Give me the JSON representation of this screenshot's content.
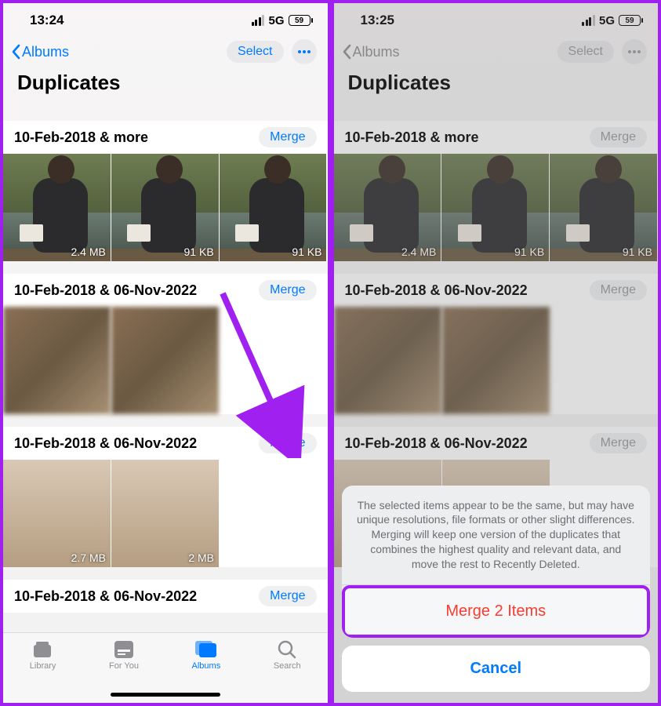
{
  "left": {
    "status": {
      "time": "13:24",
      "network": "5G",
      "battery": "59"
    },
    "nav": {
      "back_label": "Albums",
      "select_label": "Select"
    },
    "page_title": "Duplicates",
    "sections": [
      {
        "title": "10-Feb-2018 & more",
        "merge_label": "Merge",
        "thumbs": [
          {
            "size": "2.4 MB"
          },
          {
            "size": "91 KB"
          },
          {
            "size": "91 KB"
          }
        ]
      },
      {
        "title": "10-Feb-2018 & 06-Nov-2022",
        "merge_label": "Merge",
        "thumbs": [
          {
            "size": ""
          },
          {
            "size": ""
          }
        ],
        "blur": true
      },
      {
        "title": "10-Feb-2018 & 06-Nov-2022",
        "merge_label": "Merge",
        "thumbs": [
          {
            "size": "2.7 MB"
          },
          {
            "size": "2 MB"
          }
        ]
      },
      {
        "title": "10-Feb-2018 & 06-Nov-2022",
        "merge_label": "Merge",
        "thumbs": []
      }
    ],
    "tabs": {
      "library": "Library",
      "foryou": "For You",
      "albums": "Albums",
      "search": "Search"
    }
  },
  "right": {
    "status": {
      "time": "13:25",
      "network": "5G",
      "battery": "59"
    },
    "nav": {
      "back_label": "Albums",
      "select_label": "Select"
    },
    "page_title": "Duplicates",
    "sections": [
      {
        "title": "10-Feb-2018 & more",
        "merge_label": "Merge",
        "thumbs": [
          {
            "size": "2.4 MB"
          },
          {
            "size": "91 KB"
          },
          {
            "size": "91 KB"
          }
        ]
      },
      {
        "title": "10-Feb-2018 & 06-Nov-2022",
        "merge_label": "Merge",
        "thumbs": [
          {
            "size": ""
          },
          {
            "size": ""
          }
        ],
        "blur": true
      },
      {
        "title": "10-Feb-2018 & 06-Nov-2022",
        "merge_label": "Merge",
        "thumbs": []
      }
    ],
    "sheet": {
      "message": "The selected items appear to be the same, but may have unique resolutions, file formats or other slight differences. Merging will keep one version of the duplicates that combines the highest quality and relevant data, and move the rest to Recently Deleted.",
      "action_label": "Merge 2 Items",
      "cancel_label": "Cancel"
    }
  }
}
